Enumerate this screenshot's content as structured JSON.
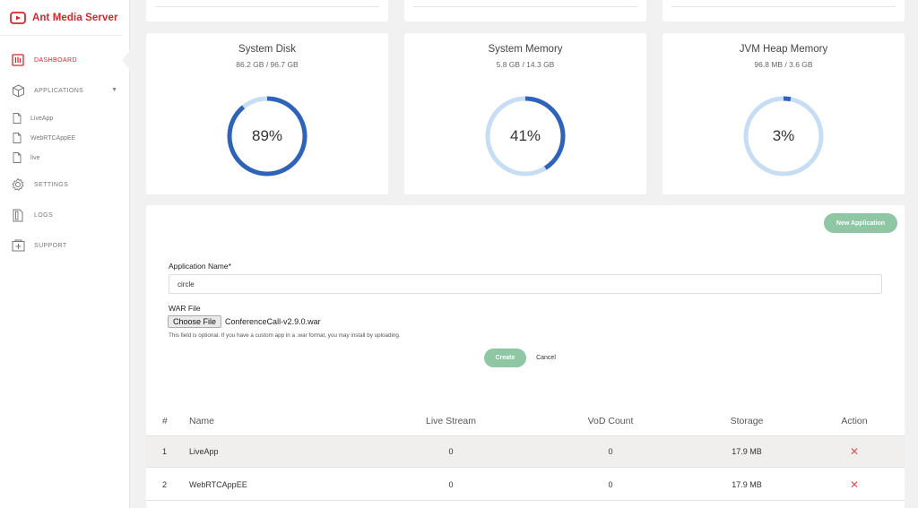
{
  "brand": {
    "name": "Ant Media Server",
    "logo_icon": "ant-media-logo-icon",
    "color": "#d7262f"
  },
  "sidebar": {
    "items": [
      {
        "label": "DASHBOARD",
        "icon": "dashboard-icon",
        "active": true
      },
      {
        "label": "APPLICATIONS",
        "icon": "box-icon",
        "expandable": true
      },
      {
        "label": "LiveApp",
        "icon": "file-icon"
      },
      {
        "label": "WebRTCAppEE",
        "icon": "file-icon"
      },
      {
        "label": "live",
        "icon": "file-icon"
      },
      {
        "label": "SETTINGS",
        "icon": "gear-icon"
      },
      {
        "label": "LOGS",
        "icon": "logs-icon"
      },
      {
        "label": "SUPPORT",
        "icon": "support-icon"
      }
    ]
  },
  "stats": [
    {
      "title": "System Disk",
      "subtitle": "86.2 GB / 96.7 GB",
      "percent_label": "89%",
      "percent": 89
    },
    {
      "title": "System Memory",
      "subtitle": "5.8 GB / 14.3 GB",
      "percent_label": "41%",
      "percent": 41
    },
    {
      "title": "JVM Heap Memory",
      "subtitle": "96.8 MB / 3.6 GB",
      "percent_label": "3%",
      "percent": 3
    }
  ],
  "gauge_colors": {
    "fill": "#2e63b8",
    "track": "#c6ddf3"
  },
  "accent_green": "#8fc6a3",
  "form": {
    "new_app_button": "New Application",
    "app_name_label": "Application Name*",
    "app_name_value": "circle",
    "war_label": "WAR File",
    "choose_file_button": "Choose File",
    "file_name": "ConferenceCall-v2.9.0.war",
    "help_text": "This field is optional. If you have a custom app in a .war format, you may install by uploading.",
    "create_button": "Create",
    "cancel_button": "Cancel"
  },
  "table": {
    "headers": [
      "#",
      "Name",
      "Live Stream",
      "VoD Count",
      "Storage",
      "Action"
    ],
    "rows": [
      {
        "index": "1",
        "name": "LiveApp",
        "live": "0",
        "vod": "0",
        "storage": "17.9 MB",
        "action_icon": "delete-x-icon"
      },
      {
        "index": "2",
        "name": "WebRTCAppEE",
        "live": "0",
        "vod": "0",
        "storage": "17.9 MB",
        "action_icon": "delete-x-icon"
      }
    ]
  }
}
